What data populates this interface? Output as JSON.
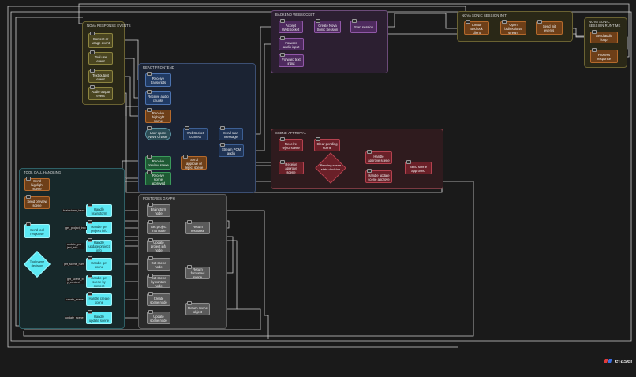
{
  "groups": {
    "nova_response": "NOVA RESPONSE EVENTS",
    "react_frontend": "REACT FRONTEND",
    "backend_ws": "BACKEND WEBSOCKET",
    "nova_sdk": "NOVA SONIC SESSION INIT",
    "nova_runtime": "NOVA SONIC SESSION RUNTIME",
    "scene_approval": "SCENE APPROVAL",
    "tool_call": "TOOL CALL HANDLING",
    "postgres": "POSTGRES GRAPH"
  },
  "nodes": {
    "content_usage": "Content or usage event",
    "tool_use": "Tool use event",
    "text_output": "Text output event",
    "audio_output": "Audio output event",
    "receive_transcripts": "Receive transcripts",
    "receive_audio": "Receive audio chunks",
    "receive_highlight": "Receive highlight scene",
    "user_opens": "User opens Nova Chaser",
    "ws_connect": "WebSocket connect",
    "send_start": "Send start message",
    "stream_pcm": "Stream PCM audio",
    "receive_preview": "Receive preview scene",
    "send_approve": "Send approve or reject scene",
    "receive_approved": "Receive scene approved",
    "accept_ws": "Accept WebSocket",
    "create_nova": "Create Nova Sonic Session",
    "start_session": "Start session",
    "forward_audio": "Forward audio input",
    "forward_text": "Forward text input",
    "create_bedrock": "Create Bedrock client",
    "open_stream": "Open bidirectional stream",
    "send_init": "Send init events",
    "send_audio_loop": "Send audio loop",
    "process_response": "Process response",
    "receive_reject": "Receive reject scene",
    "clear_pending": "Clear pending scene",
    "receive_approve": "Receive approve scene",
    "pending_decision": "Pending scene state decision",
    "handle_approve": "Handle approve scene",
    "handle_update": "Handle update scene approve",
    "send_scene_approved": "Send scene approved",
    "send_highlight": "Send highlight scene",
    "send_preview": "Send preview scene",
    "send_tool_response": "Send tool response",
    "tool_name_decision": "Tool name decision",
    "handle_brainstorm": "Handle brainstorm",
    "handle_get_project": "Handle get project info",
    "handle_update_project": "Handle update project info",
    "handle_get_scene": "Handle get scene",
    "handle_get_scene_content": "Handle get scene by content",
    "handle_create_scene": "Handle create scene",
    "handle_update_scene": "Handle update scene",
    "brainstorm_node": "Brainstorm node",
    "get_project_node": "Get project info node",
    "update_project_node": "Update project info node",
    "get_scene_node": "Get scene node",
    "get_scene_content_node": "Get scene by content node",
    "create_scene_node": "Create scene node",
    "update_scene_node": "Update scene node",
    "return_response": "Return response",
    "return_formatted": "Return formatted scene",
    "return_scene_object": "Return scene object"
  },
  "edge_labels": {
    "brainstorm_ideas": "brainstorm_ideas",
    "get_project_info": "get_project_info",
    "update_project_info": "update_pro ject_info",
    "get_scene_num": "get_scene_num",
    "get_scene_content": "get_scene_b y_content",
    "create_scene": "create_scene",
    "update_scene": "update_scene"
  },
  "brand": "eraser",
  "colors": {
    "background": "#1a1a1a",
    "edge": "#cfcfcf",
    "yellow_group": "#2a2817",
    "blue_group": "#1b2333",
    "purple_group": "#2c1f31",
    "red_group": "#2f1b1e",
    "teal_group": "#17282a",
    "gray_group": "#2a2a2a",
    "cyan_node": "#5ce9f4"
  }
}
